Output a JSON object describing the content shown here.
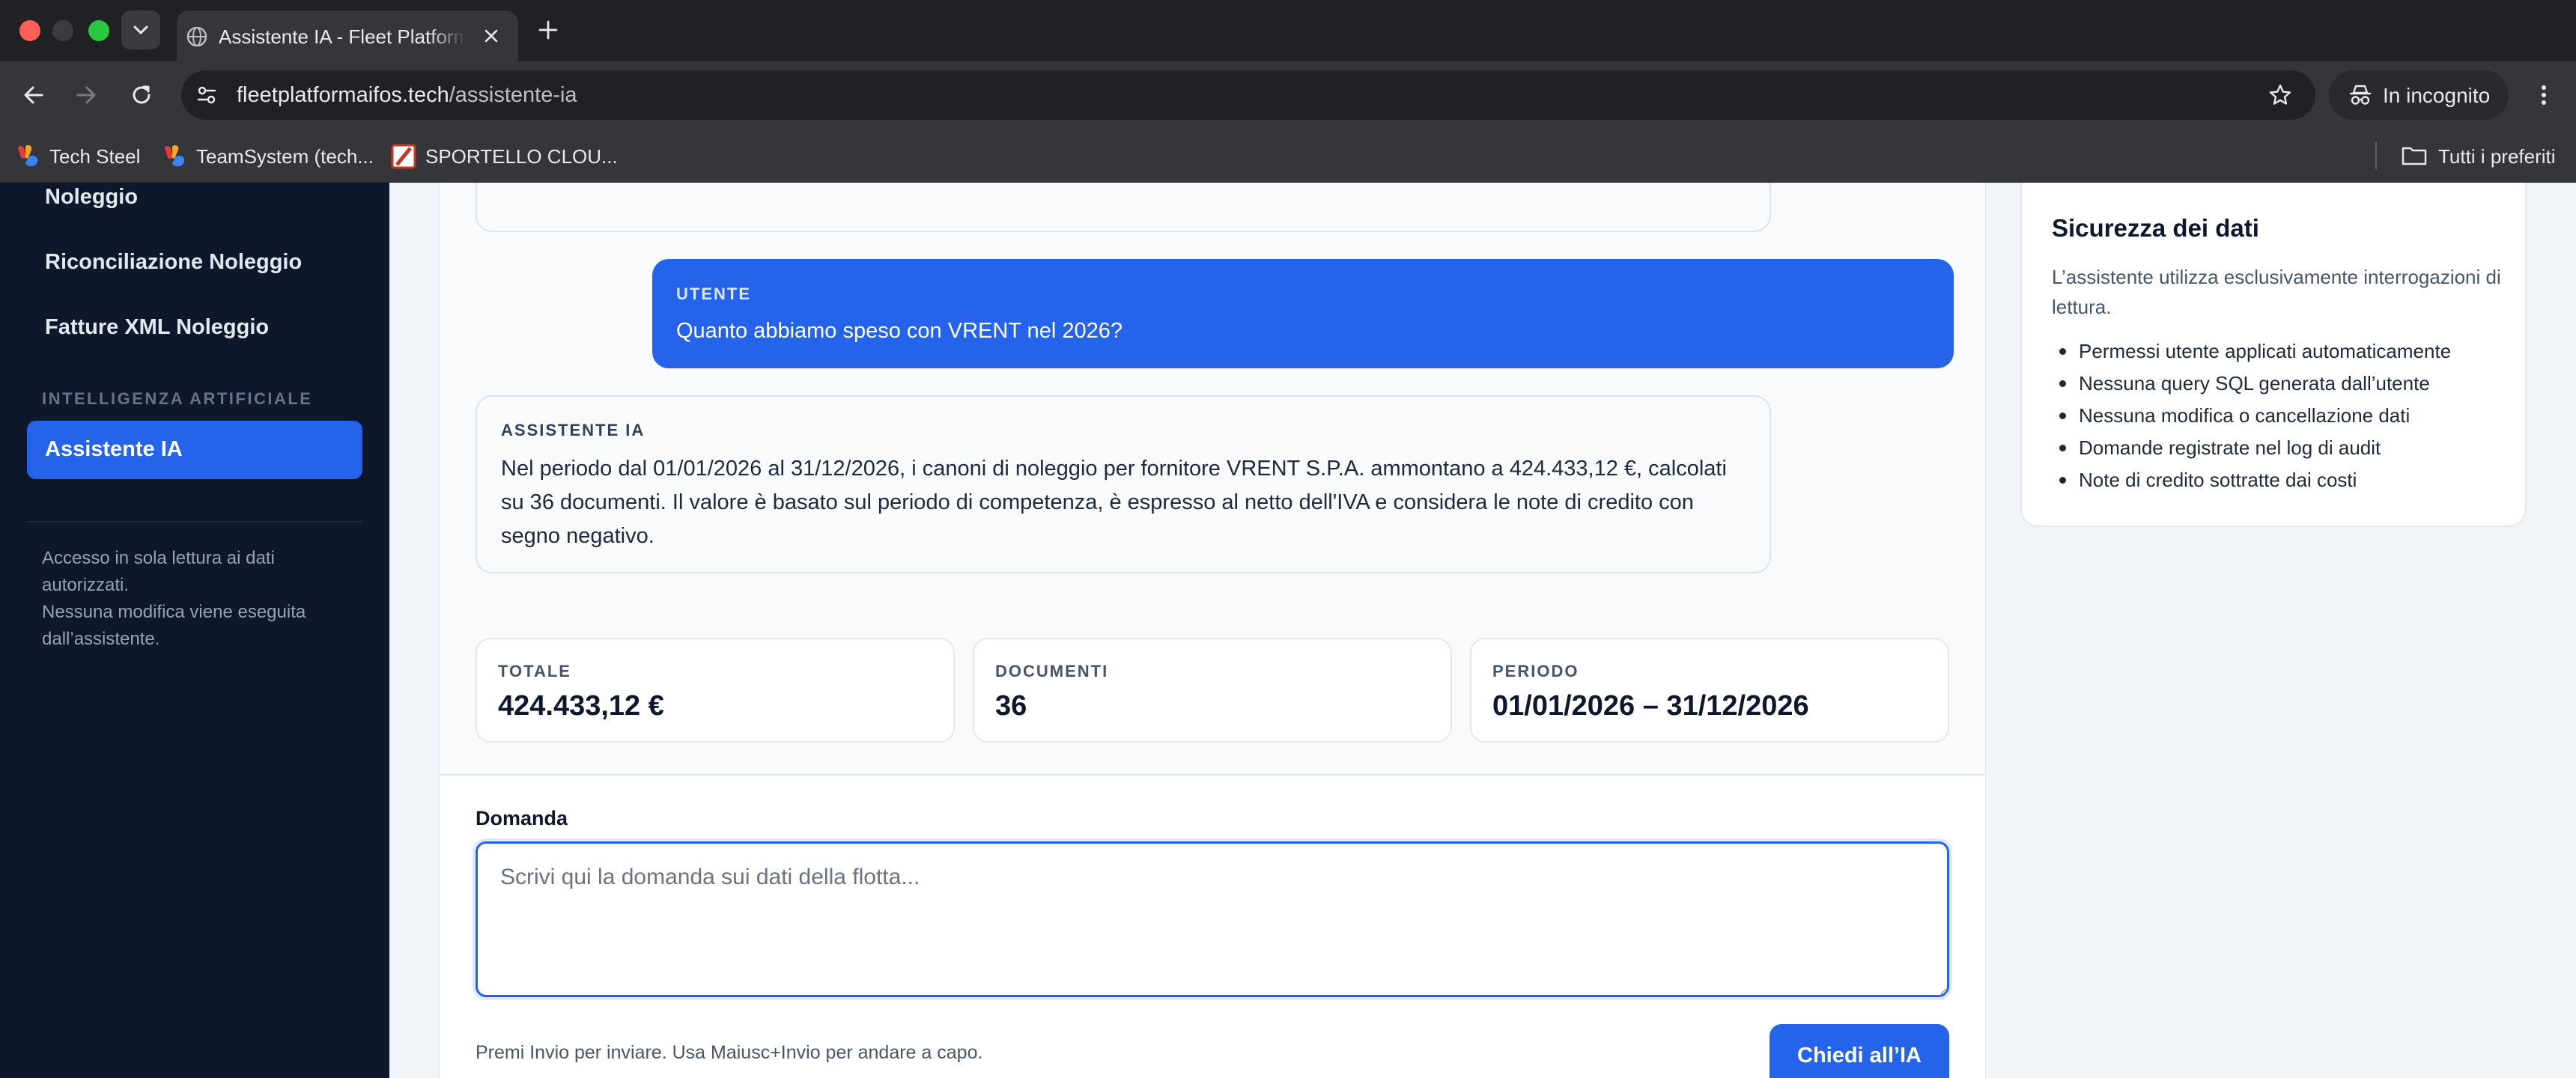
{
  "browser": {
    "tab_title": "Assistente IA - Fleet Platform",
    "url_host": "fleetplatformaifos.tech",
    "url_path": "/assistente-ia",
    "incognito_label": "In incognito",
    "bookmarks": [
      {
        "label": "Tech Steel"
      },
      {
        "label": "TeamSystem (tech..."
      },
      {
        "label": "SPORTELLO CLOU..."
      }
    ],
    "bookmarks_folder": "Tutti i preferiti"
  },
  "sidebar": {
    "items": [
      {
        "label": "Noleggio"
      },
      {
        "label": "Riconciliazione Noleggio"
      },
      {
        "label": "Fatture XML Noleggio"
      }
    ],
    "section_title": "INTELLIGENZA ARTIFICIALE",
    "active_item": "Assistente IA",
    "note_line1": "Accesso in sola lettura ai dati autorizzati.",
    "note_line2": "Nessuna modifica viene eseguita dall’assistente."
  },
  "chat": {
    "user_role": "UTENTE",
    "user_message": "Quanto abbiamo speso con VRENT nel 2026?",
    "ai_role": "ASSISTENTE IA",
    "ai_message": "Nel periodo dal 01/01/2026 al 31/12/2026, i canoni di noleggio per fornitore VRENT S.P.A. ammontano a 424.433,12 €, calcolati su 36 documenti. Il valore è basato sul periodo di competenza, è espresso al netto dell'IVA e considera le note di credito con segno negativo."
  },
  "stats": [
    {
      "label": "TOTALE",
      "value": "424.433,12 €"
    },
    {
      "label": "DOCUMENTI",
      "value": "36"
    },
    {
      "label": "PERIODO",
      "value": "01/01/2026 – 31/12/2026"
    }
  ],
  "composer": {
    "label": "Domanda",
    "placeholder": "Scrivi qui la domanda sui dati della flotta...",
    "value": "",
    "hint": "Premi Invio per inviare. Usa Maiusc+Invio per andare a capo.",
    "submit_label": "Chiedi all’IA"
  },
  "security_panel": {
    "title": "Sicurezza dei dati",
    "description": "L’assistente utilizza esclusivamente interrogazioni di lettura.",
    "items": [
      "Permessi utente applicati automaticamente",
      "Nessuna query SQL generata dall’utente",
      "Nessuna modifica o cancellazione dati",
      "Domande registrate nel log di audit",
      "Note di credito sottratte dai costi"
    ]
  },
  "colors": {
    "accent": "#2563eb",
    "sidebar_bg": "#0f172a"
  }
}
